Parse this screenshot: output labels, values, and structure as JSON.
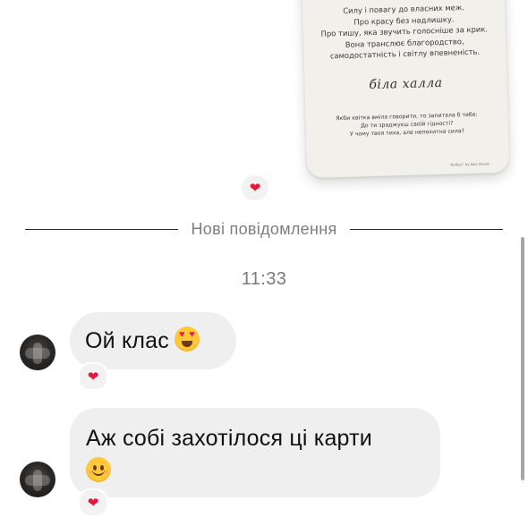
{
  "shared_card": {
    "poem_lines": [
      "Силу і повагу до власних меж.",
      "Про красу без надлишку.",
      "Про тишу, яка звучить голосніше за крик.",
      "Вона транслює благородство,",
      "самодостатність і світлу впевненість."
    ],
    "title": "біла халла",
    "question_lines": [
      "Якби квітка вміла говорити, то запитала б тебе:",
      "До ти зраджуєш своїй гідності?",
      "У чому твоя тиха, але непохитна сила?"
    ],
    "footer": "\"Reflect\" by Kolo Studio"
  },
  "shared_card_reaction": "❤",
  "divider_label": "Нові повідомлення",
  "timestamp": "11:33",
  "messages": [
    {
      "text": "Ой клас",
      "emoji": "smiling-face-with-heart-eyes",
      "reaction": "❤"
    },
    {
      "text": "Аж собі захотілося ці карти",
      "emoji": "smiling-face-with-smiling-eyes",
      "reaction": "❤"
    }
  ],
  "colors": {
    "bubble": "#efefef",
    "divider_text": "#7e7e7e",
    "timestamp_text": "#7a7a7a",
    "reaction_heart": "#e8163a",
    "card_bg": "#f2f0eb"
  }
}
